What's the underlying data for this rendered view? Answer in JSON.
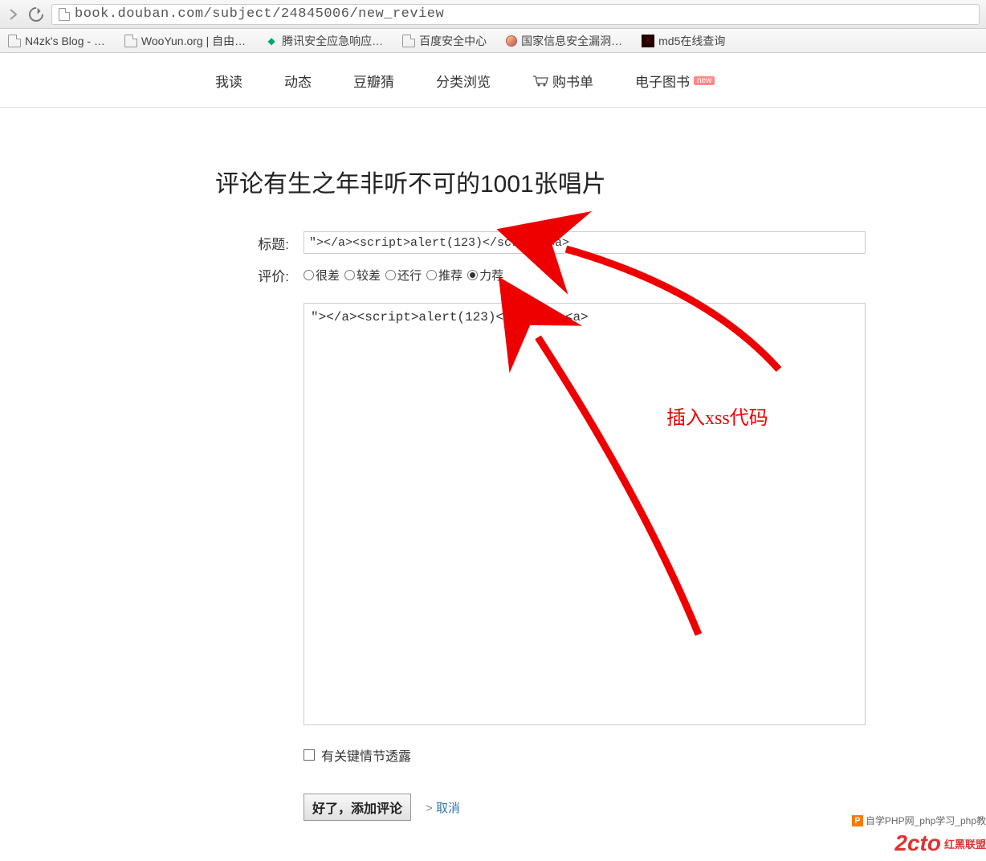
{
  "browser": {
    "url": "book.douban.com/subject/24845006/new_review"
  },
  "bookmarks": [
    {
      "icon": "page",
      "label": "N4zk's Blog - …"
    },
    {
      "icon": "page",
      "label": "WooYun.org | 自由…"
    },
    {
      "icon": "shield",
      "label": "腾讯安全应急响应…"
    },
    {
      "icon": "page",
      "label": "百度安全中心"
    },
    {
      "icon": "globe",
      "label": "国家信息安全漏洞…"
    },
    {
      "icon": "dark",
      "label": "md5在线查询"
    }
  ],
  "nav": {
    "items": [
      "我读",
      "动态",
      "豆瓣猜",
      "分类浏览"
    ],
    "cart": "购书单",
    "ebook": "电子图书",
    "badge": "new"
  },
  "page": {
    "title": "评论有生之年非听不可的1001张唱片",
    "labels": {
      "title": "标题:",
      "rating": "评价:"
    },
    "title_value": "\"></a><script>alert(123)</script><a>",
    "ratings": [
      "很差",
      "较差",
      "还行",
      "推荐",
      "力荐"
    ],
    "rating_selected": 4,
    "content_value": "\"></a><script>alert(123)</script><a>",
    "spoiler": "有关键情节透露",
    "submit": "好了，添加评论",
    "cancel": "取消"
  },
  "annotation": {
    "text": "插入xss代码"
  },
  "watermark": {
    "php_icon": "P",
    "php_text": "自学PHP网_php学习_php教",
    "brand": "2cto",
    "brand_sub": "红黑联盟"
  }
}
